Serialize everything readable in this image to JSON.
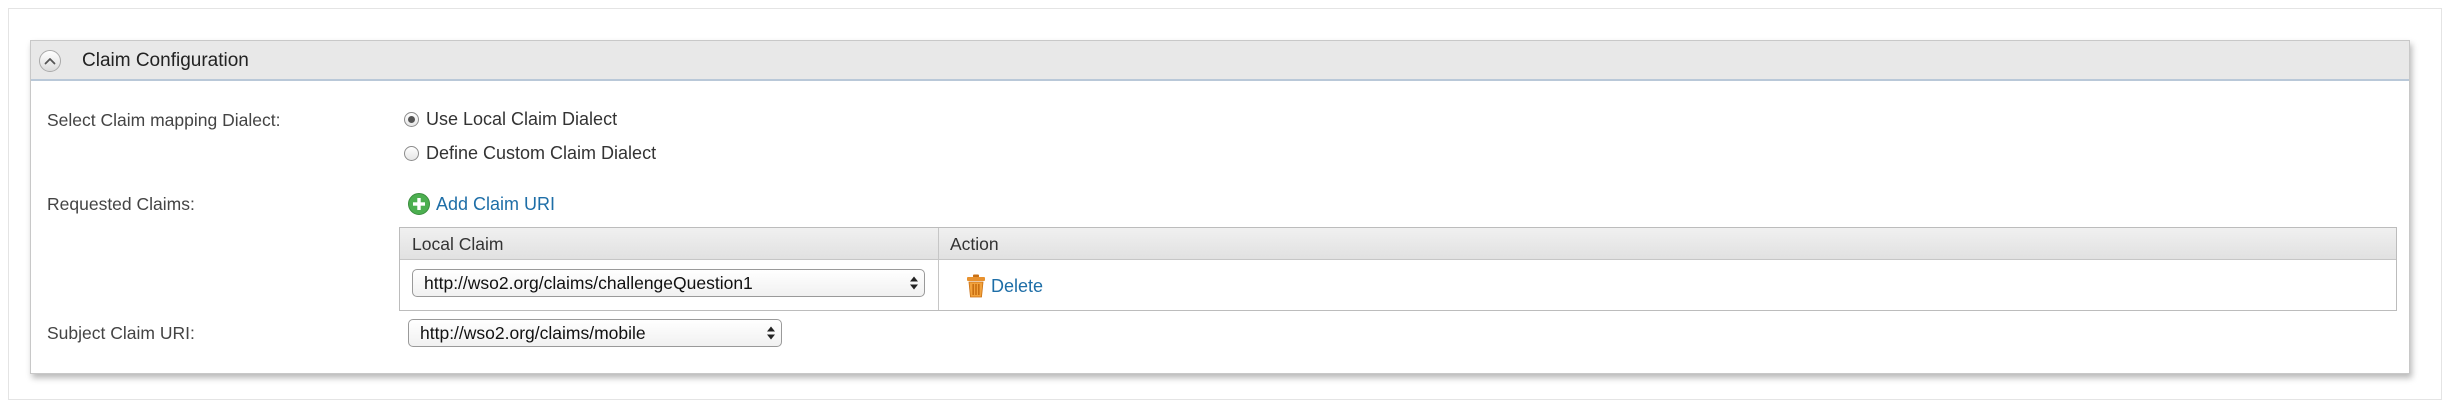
{
  "panel": {
    "title": "Claim Configuration"
  },
  "dialect": {
    "label": "Select Claim mapping Dialect:",
    "options": [
      {
        "label": "Use Local Claim Dialect",
        "checked": true
      },
      {
        "label": "Define Custom Claim Dialect",
        "checked": false
      }
    ]
  },
  "requested_claims": {
    "label": "Requested Claims:",
    "add_label": "Add Claim URI",
    "add_icon": "plus-circle-icon",
    "table": {
      "headers": [
        "Local Claim",
        "Action"
      ],
      "rows": [
        {
          "local_claim": "http://wso2.org/claims/challengeQuestion1",
          "action": "Delete",
          "action_icon": "trash-icon"
        }
      ]
    }
  },
  "subject_claim": {
    "label": "Subject Claim URI:",
    "value": "http://wso2.org/claims/mobile"
  },
  "colors": {
    "link": "#1e6ea7",
    "add_icon": "#4caf50",
    "trash_icon": "#e8922f",
    "header_bg": "#e8e8e8"
  }
}
